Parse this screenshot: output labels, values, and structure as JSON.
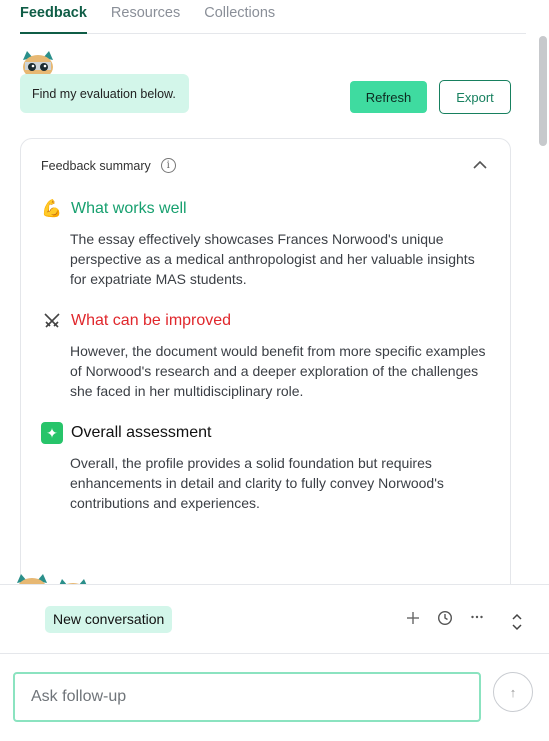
{
  "tabs": [
    {
      "label": "Feedback",
      "active": true
    },
    {
      "label": "Resources",
      "active": false
    },
    {
      "label": "Collections",
      "active": false
    }
  ],
  "message": {
    "text": "Find my evaluation below."
  },
  "actions": {
    "refresh_label": "Refresh",
    "export_label": "Export"
  },
  "summary": {
    "title": "Feedback summary",
    "sections": [
      {
        "icon": "flexed-biceps-icon",
        "title": "What works well",
        "body": "The essay effectively showcases Frances Norwood's unique perspective as a medical anthropologist and her valuable insights for expatriate MAS students."
      },
      {
        "icon": "crossed-swords-icon",
        "title": "What can be improved",
        "body": "However, the document would benefit from more specific examples of Norwood's research and a deeper exploration of the challenges she faced in her multidisciplinary role."
      },
      {
        "icon": "sparkles-icon",
        "title": "Overall assessment",
        "body": "Overall, the profile provides a solid foundation but requires enhancements in detail and clarity to fully convey Norwood's contributions and experiences."
      }
    ]
  },
  "conversation": {
    "label": "New conversation"
  },
  "followup": {
    "placeholder": "Ask follow-up"
  },
  "colors": {
    "accent": "#3fdba0",
    "brand_dark": "#0f5d46",
    "positive": "#17a06f",
    "negative": "#e0272c",
    "bubble": "#d3f6ea"
  }
}
